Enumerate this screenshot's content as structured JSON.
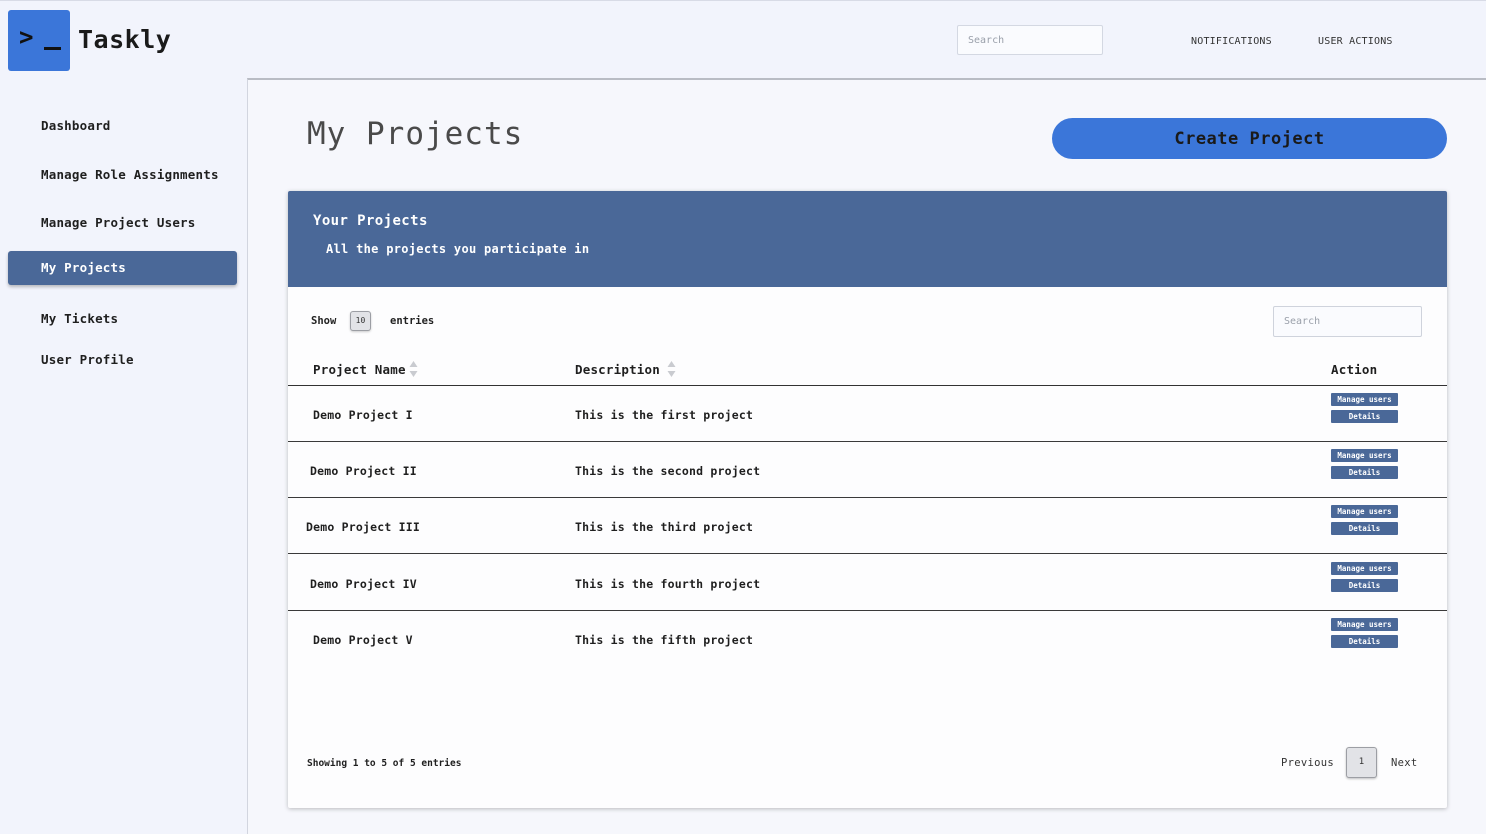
{
  "app": {
    "brand": "Taskly",
    "logo_glyph": ">",
    "logo_icon": "terminal-prompt-icon"
  },
  "header": {
    "search_placeholder": "Search",
    "notifications": "NOTIFICATIONS",
    "user_actions": "USER ACTIONS"
  },
  "sidebar": {
    "items": [
      {
        "label": "Dashboard",
        "active": false
      },
      {
        "label": "Manage Role Assignments",
        "active": false
      },
      {
        "label": "Manage Project Users",
        "active": false
      },
      {
        "label": "My Projects",
        "active": true
      },
      {
        "label": "My Tickets",
        "active": false
      },
      {
        "label": "User Profile",
        "active": false
      }
    ]
  },
  "main": {
    "title": "My Projects",
    "create_button": "Create Project"
  },
  "card": {
    "title": "Your Projects",
    "subtitle": "All the projects you participate in",
    "show_label": "Show",
    "entries_value": "10",
    "entries_label": "entries",
    "search_placeholder": "Search"
  },
  "table": {
    "columns": [
      "Project Name",
      "Description",
      "Action"
    ],
    "rows": [
      {
        "name": "Demo Project I",
        "description": "This is the first project",
        "manage": "Manage users",
        "details": "Details"
      },
      {
        "name": "Demo Project II",
        "description": "This is the second project",
        "manage": "Manage users",
        "details": "Details"
      },
      {
        "name": "Demo Project III",
        "description": "This is the third project",
        "manage": "Manage users",
        "details": "Details"
      },
      {
        "name": "Demo Project IV",
        "description": "This is the fourth project",
        "manage": "Manage users",
        "details": "Details"
      },
      {
        "name": "Demo Project V",
        "description": "This is the fifth project",
        "manage": "Manage users",
        "details": "Details"
      }
    ]
  },
  "pagination": {
    "summary": "Showing 1 to 5 of 5 entries",
    "previous": "Previous",
    "current": "1",
    "next": "Next"
  },
  "colors": {
    "accent": "#3b76d9",
    "panel": "#4a6898",
    "background": "#f2f4fc"
  }
}
